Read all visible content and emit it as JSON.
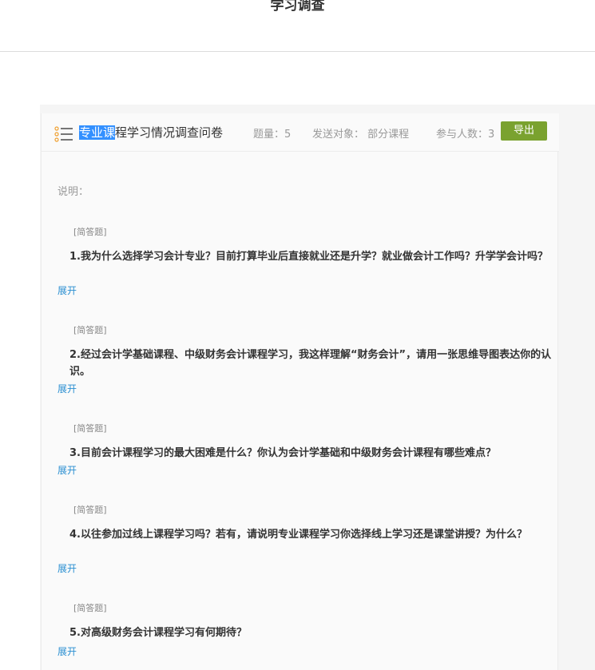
{
  "page": {
    "title": "学习调查"
  },
  "survey": {
    "title_highlight": "专业课",
    "title_rest": "程学习情况调查问卷",
    "question_count": "题量：5",
    "send_target": "发送对象： 部分课程",
    "participants": "参与人数：3",
    "export_label": "导出",
    "description_label": "说明："
  },
  "questions": [
    {
      "type": "[简答题]",
      "text": "1.我为什么选择学习会计专业？目前打算毕业后直接就业还是升学？就业做会计工作吗？升学学会计吗？",
      "expand": "展开"
    },
    {
      "type": "[简答题]",
      "text": "2.经过会计学基础课程、中级财务会计课程学习，我这样理解“财务会计”，请用一张思维导图表达你的认识。",
      "expand": "展开"
    },
    {
      "type": "[简答题]",
      "text": "3.目前会计课程学习的最大困难是什么？你认为会计学基础和中级财务会计课程有哪些难点？",
      "expand": "展开"
    },
    {
      "type": "[简答题]",
      "text": "4.以往参加过线上课程学习吗？若有，请说明专业课程学习你选择线上学习还是课堂讲授？为什么？",
      "expand": "展开"
    },
    {
      "type": "[简答题]",
      "text": "5.对高级财务会计课程学习有何期待？",
      "expand": "展开"
    }
  ],
  "colors": {
    "accent_green": "#7aa22f",
    "link_blue": "#2a8fd1",
    "icon_orange": "#f0a030"
  },
  "icons": {
    "list": "list-icon"
  }
}
